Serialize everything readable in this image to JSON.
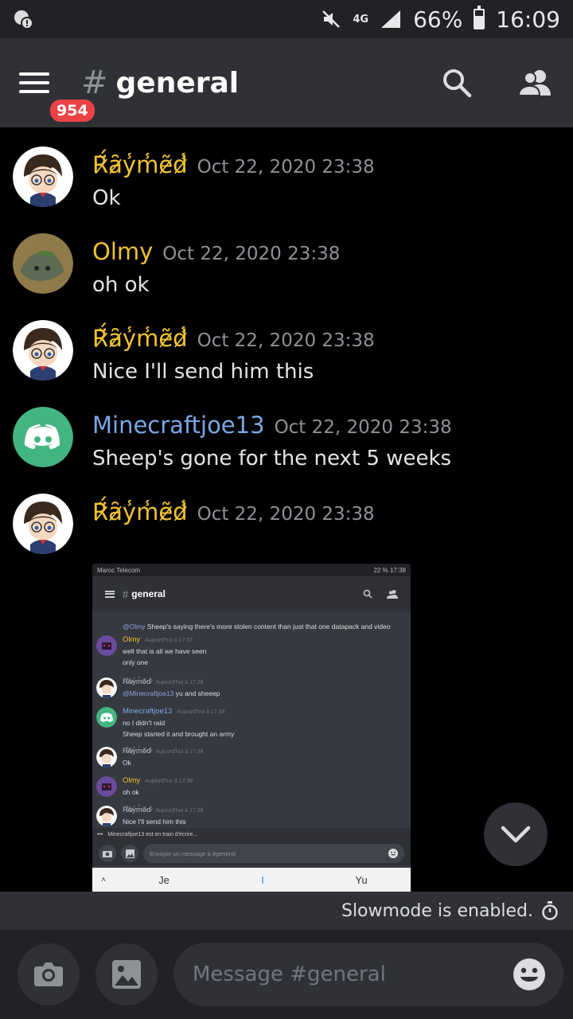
{
  "status_bar": {
    "network": "4G",
    "battery_text": "66%",
    "battery_level": 0.66,
    "time": "16:09"
  },
  "header": {
    "notification_badge": "954",
    "hash": "#",
    "channel_name": "general"
  },
  "messages": [
    {
      "username": "R̷̈́ȃ̷y̾m̾ẽ̷d̷̾",
      "color": "#f0c232",
      "timestamp": "Oct 22, 2020 23:38",
      "text": "Ok"
    },
    {
      "username": "Olmy",
      "color": "#f0c232",
      "timestamp": "Oct 22, 2020 23:38",
      "text": "oh ok"
    },
    {
      "username": "R̷̈́ȃ̷y̾m̾ẽ̷d̷̾",
      "color": "#f0c232",
      "timestamp": "Oct 22, 2020 23:38",
      "text": "Nice I'll send him this"
    },
    {
      "username": "Minecraftjoe13",
      "color": "#7aa7e6",
      "timestamp": "Oct 22, 2020 23:38",
      "text": "Sheep's gone for the next 5 weeks"
    },
    {
      "username": "R̷̈́ȃ̷y̾m̾ẽ̷d̷̾",
      "color": "#f0c232",
      "timestamp": "Oct 22, 2020 23:38",
      "text": ""
    }
  ],
  "attachment": {
    "carrier": "Maroc Telecom",
    "status_right": "22 % 17:38",
    "channel_name": "general",
    "top_line_mention": "@Olmy",
    "top_line": " Sheep's saying there's more stolen content than just that one datapack and video",
    "messages": [
      {
        "username": "Olmy",
        "color": "#f0c232",
        "time": "Aujourd'hui à 17:37",
        "lines": [
          "well that is all we have seen",
          "only one"
        ]
      },
      {
        "username": "R̷̈́ȃ̷y̾m̾ẽ̷d̷̾",
        "color": "#b9bbbe",
        "time": "Aujourd'hui à 17:38",
        "mention": "@Minecraftjoe13",
        "lines": [
          " yu and sheeep"
        ]
      },
      {
        "username": "Minecraftjoe13",
        "color": "#7aa7e6",
        "time": "Aujourd'hui à 17:38",
        "lines": [
          "no I didn't raid",
          "Sheep started it and brought an army"
        ]
      },
      {
        "username": "R̷̈́ȃ̷y̾m̾ẽ̷d̷̾",
        "color": "#b9bbbe",
        "time": "Aujourd'hui à 17:38",
        "lines": [
          "Ok"
        ]
      },
      {
        "username": "Olmy",
        "color": "#f0c232",
        "time": "Aujourd'hui à 17:38",
        "lines": [
          "oh ok"
        ]
      },
      {
        "username": "R̷̈́ȃ̷y̾m̾ẽ̷d̷̾",
        "color": "#b9bbbe",
        "time": "Aujourd'hui à 17:38",
        "lines": [
          "Nice I'll send him this"
        ]
      }
    ],
    "typing": "Minecraftjoe13 est en train d'écrire...",
    "input_placeholder": "Envoyer un message à #general",
    "keyboard": [
      "Je",
      "I",
      "Yu"
    ]
  },
  "slowmode": {
    "text": "Slowmode is enabled."
  },
  "composer": {
    "placeholder": "Message #general"
  },
  "colors": {
    "accent_red": "#ed4245",
    "username_yellow": "#f0c232",
    "username_blue": "#7aa7e6",
    "discord_green": "#43b581"
  }
}
